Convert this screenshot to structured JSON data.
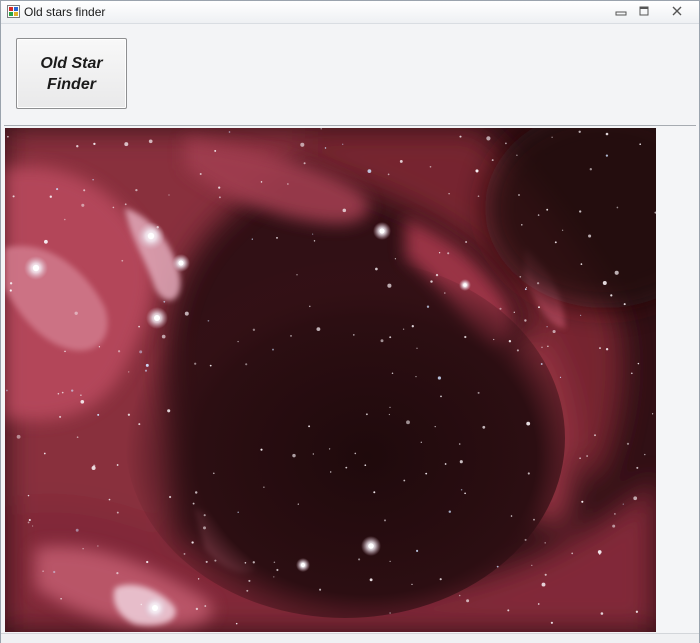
{
  "window": {
    "title": "Old stars finder",
    "app_icon": "app-icon",
    "controls": [
      "minimize-icon",
      "maximize-icon",
      "close-icon"
    ]
  },
  "toolbar": {
    "finder_button_label": "Old Star Finder"
  },
  "image": {
    "subject": "nebula star field",
    "palette": [
      "#2b0d10",
      "#7a2331",
      "#c85a6e",
      "#f2e7ee"
    ]
  }
}
